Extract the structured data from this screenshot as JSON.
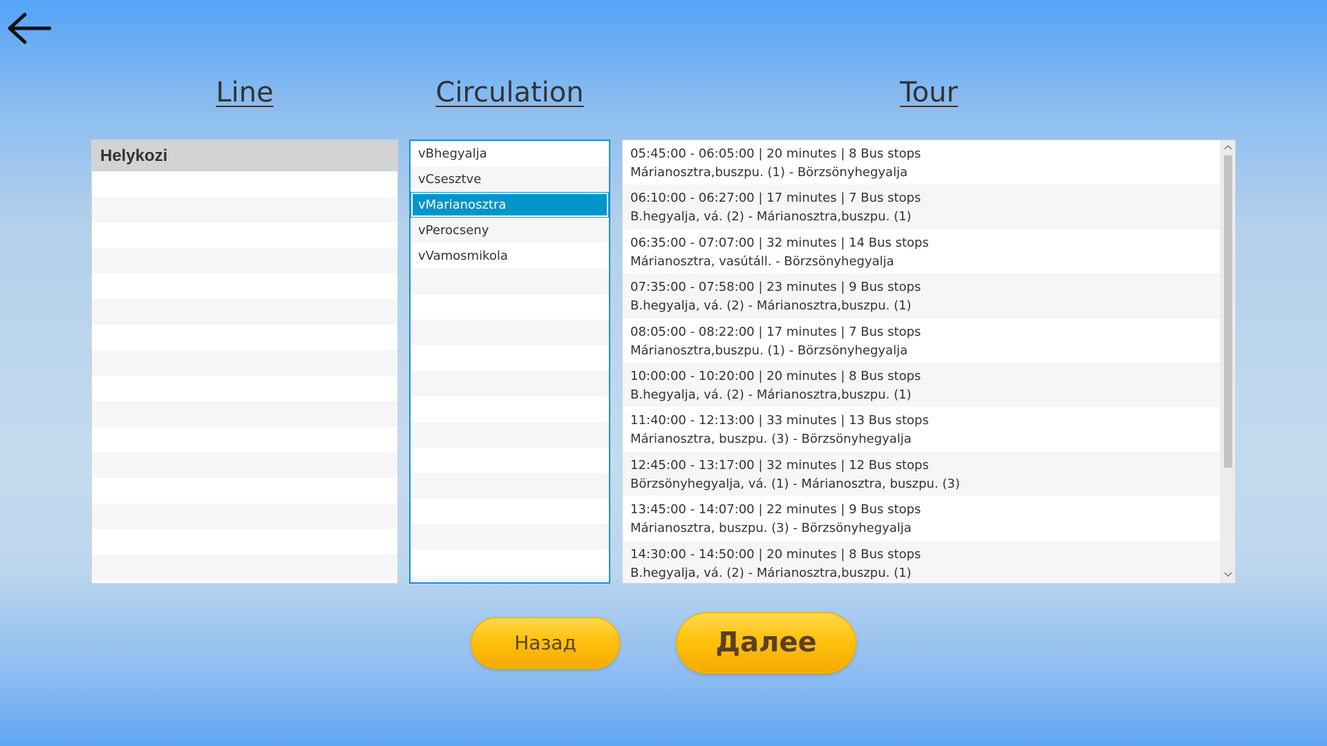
{
  "headers": {
    "line": "Line",
    "circulation": "Circulation",
    "tour": "Tour"
  },
  "line_list": {
    "selected": "Helykozi"
  },
  "circulation_list": {
    "items": [
      "vBhegyalja",
      "vCsesztve",
      "vMarianosztra",
      "vPerocseny",
      "vVamosmikola"
    ],
    "selected_index": 2
  },
  "tour_list": {
    "items": [
      {
        "time": "05:45:00 - 06:05:00 | 20 minutes | 8 Bus stops",
        "route": "Márianosztra,buszpu. (1) - Börzsönyhegyalja"
      },
      {
        "time": "06:10:00 - 06:27:00 | 17 minutes | 7 Bus stops",
        "route": "B.hegyalja, vá. (2) - Márianosztra,buszpu. (1)"
      },
      {
        "time": "06:35:00 - 07:07:00 | 32 minutes | 14 Bus stops",
        "route": "Márianosztra, vasútáll. - Börzsönyhegyalja"
      },
      {
        "time": "07:35:00 - 07:58:00 | 23 minutes | 9 Bus stops",
        "route": "B.hegyalja, vá. (2) - Márianosztra,buszpu. (1)"
      },
      {
        "time": "08:05:00 - 08:22:00 | 17 minutes | 7 Bus stops",
        "route": "Márianosztra,buszpu. (1) - Börzsönyhegyalja"
      },
      {
        "time": "10:00:00 - 10:20:00 | 20 minutes | 8 Bus stops",
        "route": "B.hegyalja, vá. (2) - Márianosztra,buszpu. (1)"
      },
      {
        "time": "11:40:00 - 12:13:00 | 33 minutes | 13 Bus stops",
        "route": "Márianosztra, buszpu. (3) - Börzsönyhegyalja"
      },
      {
        "time": "12:45:00 - 13:17:00 | 32 minutes | 12 Bus stops",
        "route": "Börzsönyhegyalja, vá. (1) - Márianosztra, buszpu. (3)"
      },
      {
        "time": "13:45:00 - 14:07:00 | 22 minutes | 9 Bus stops",
        "route": "Márianosztra, buszpu. (3) - Börzsönyhegyalja"
      },
      {
        "time": "14:30:00 - 14:50:00 | 20 minutes | 8 Bus stops",
        "route": "B.hegyalja, vá. (2) - Márianosztra,buszpu. (1)"
      }
    ]
  },
  "buttons": {
    "back": "Назад",
    "next": "Далее"
  },
  "icons": {
    "back": "arrow-left-icon",
    "scroll_up": "chevron-up-icon",
    "scroll_down": "chevron-down-icon"
  },
  "colors": {
    "selection": "#0096c9",
    "button_yellow": "#ffc20e",
    "button_text": "#5a4020"
  }
}
